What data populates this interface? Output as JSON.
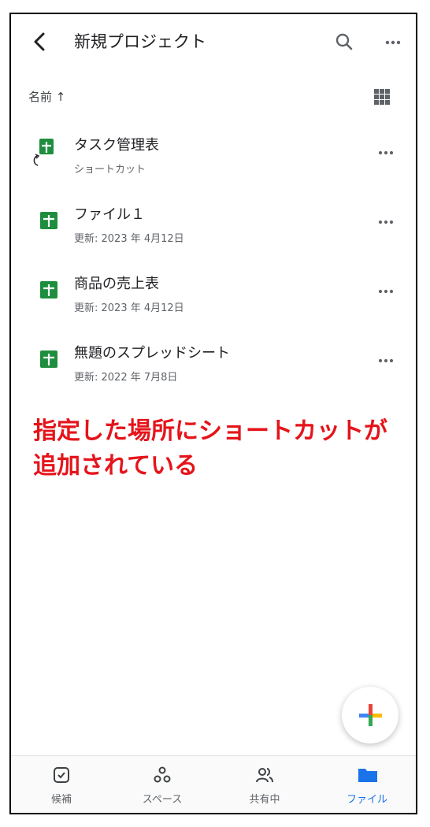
{
  "header": {
    "title": "新規プロジェクト",
    "back_icon": "chevron-left-icon",
    "search_icon": "search-icon",
    "more_icon": "more-horizontal-icon"
  },
  "sort": {
    "label": "名前 ↑",
    "view_icon": "grid-view-icon"
  },
  "files": [
    {
      "name": "タスク管理表",
      "subtitle": "ショートカット",
      "icon": "sheets-shortcut-icon"
    },
    {
      "name": "ファイル１",
      "subtitle": "更新: 2023 年 4月12日",
      "icon": "sheets-icon"
    },
    {
      "name": "商品の売上表",
      "subtitle": "更新: 2023 年 4月12日",
      "icon": "sheets-icon"
    },
    {
      "name": "無題のスプレッドシート",
      "subtitle": "更新: 2022 年 7月8日",
      "icon": "sheets-icon"
    }
  ],
  "annotation": "指定した場所にショートカットが追加されている",
  "colors": {
    "sheets_green": "#1e8e3e",
    "annotation_red": "#e5141b",
    "active_blue": "#1a73e8"
  },
  "bottom_nav": [
    {
      "label": "候補",
      "icon": "suggested-icon"
    },
    {
      "label": "スペース",
      "icon": "spaces-icon"
    },
    {
      "label": "共有中",
      "icon": "shared-icon"
    },
    {
      "label": "ファイル",
      "icon": "folder-icon",
      "active": true
    }
  ]
}
